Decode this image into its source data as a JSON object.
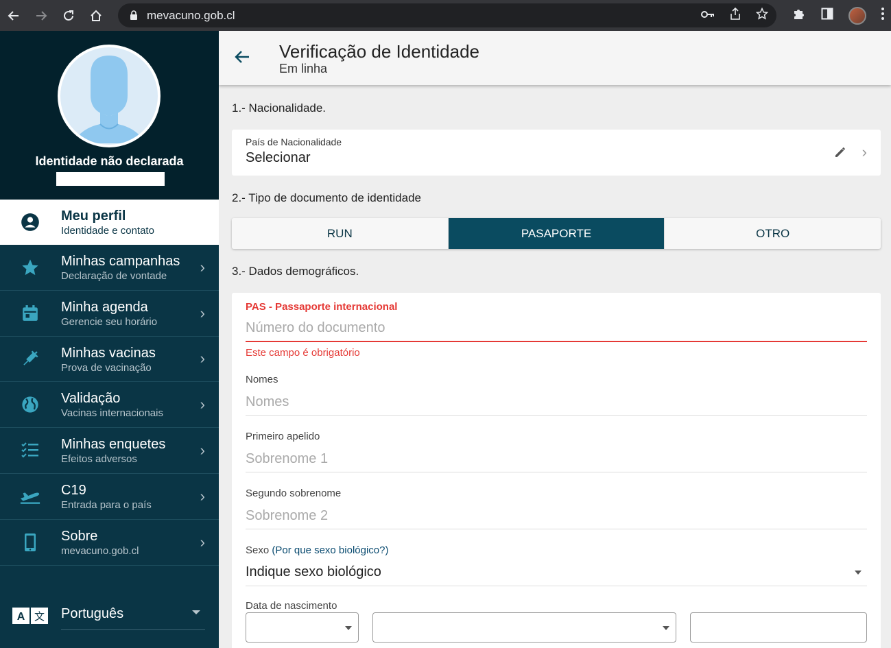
{
  "browser": {
    "url": "mevacuno.gob.cl"
  },
  "sidebar": {
    "profile_name": "Identidade não declarada",
    "items": [
      {
        "title": "Meu perfil",
        "subtitle": "Identidade e contato"
      },
      {
        "title": "Minhas campanhas",
        "subtitle": "Declaração de vontade"
      },
      {
        "title": "Minha agenda",
        "subtitle": "Gerencie seu horário"
      },
      {
        "title": "Minhas vacinas",
        "subtitle": "Prova de vacinação"
      },
      {
        "title": "Validação",
        "subtitle": "Vacinas internacionais"
      },
      {
        "title": "Minhas enquetes",
        "subtitle": "Efeitos adversos"
      },
      {
        "title": "C19",
        "subtitle": "Entrada para o país"
      },
      {
        "title": "Sobre",
        "subtitle": "mevacuno.gob.cl"
      }
    ],
    "language": "Português"
  },
  "header": {
    "title": "Verificação de Identidade",
    "subtitle": "Em linha"
  },
  "section1": {
    "heading": "1.- Nacionalidade.",
    "field_label": "País de Nacionalidade",
    "field_value": "Selecionar"
  },
  "section2": {
    "heading": "2.- Tipo de documento de identidade",
    "options": [
      "RUN",
      "PASAPORTE",
      "OTRO"
    ],
    "selected": "PASAPORTE"
  },
  "section3": {
    "heading": "3.- Dados demográficos.",
    "doc_label": "PAS - Passaporte internacional",
    "doc_placeholder": "Número do documento",
    "doc_error": "Este campo é obrigatório",
    "names_label": "Nomes",
    "names_placeholder": "Nomes",
    "last1_label": "Primeiro apelido",
    "last1_placeholder": "Sobrenome 1",
    "last2_label": "Segundo sobrenome",
    "last2_placeholder": "Sobrenome 2",
    "sex_label": "Sexo",
    "sex_link": "(Por que sexo biológico?)",
    "sex_value": "Indique sexo biológico",
    "dob_label": "Data de nascimento"
  },
  "colors": {
    "sidebar_bg": "#0a3545",
    "accent": "#0a4b60",
    "error": "#e53935",
    "icon_teal": "#3aa6c0"
  }
}
